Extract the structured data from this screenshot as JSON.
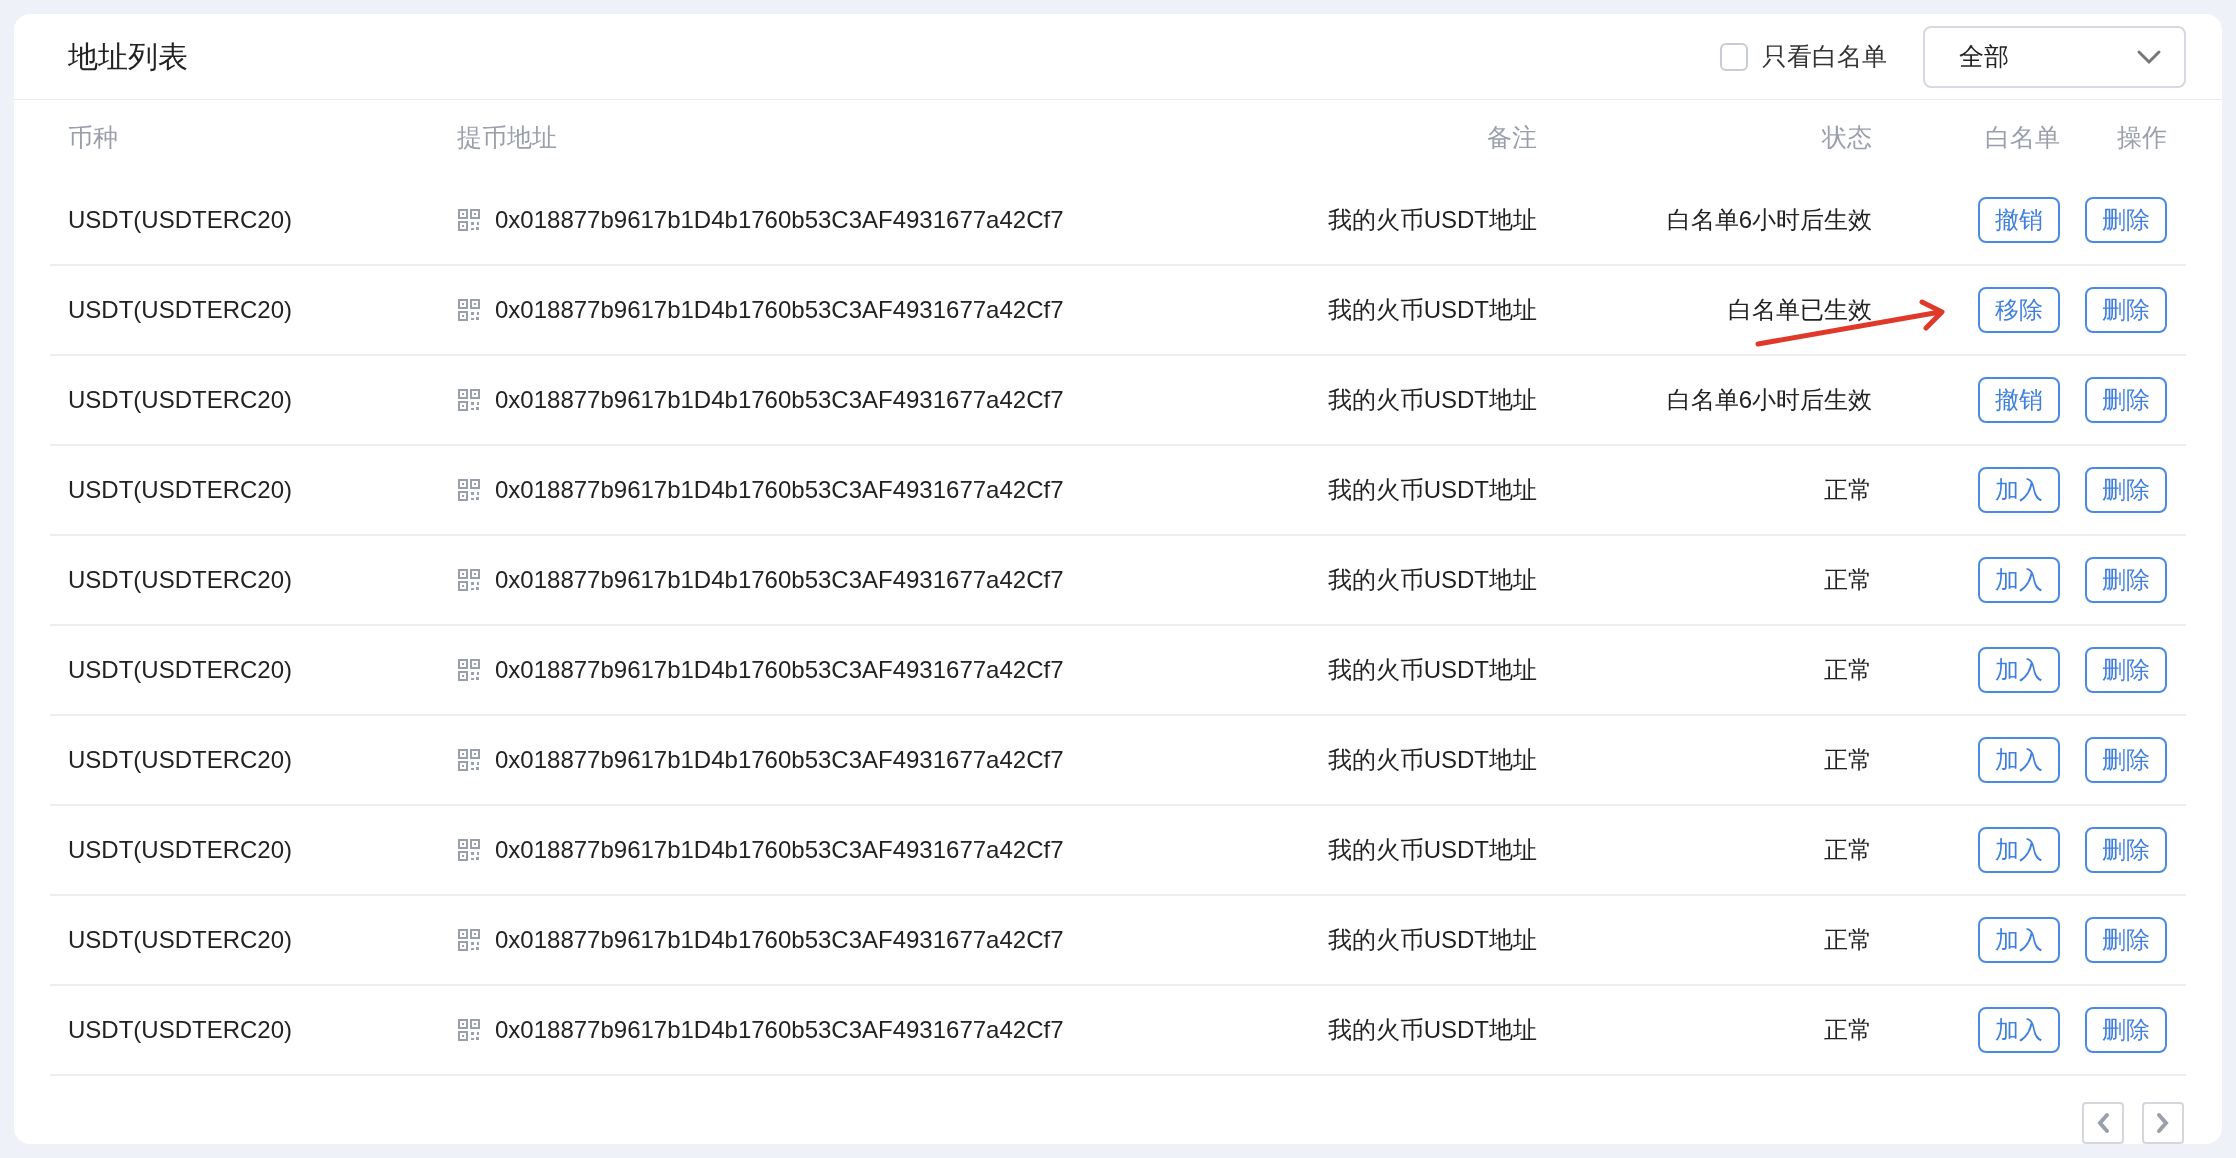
{
  "title": "地址列表",
  "filter": {
    "label": "只看白名单",
    "checked": false
  },
  "select": {
    "value": "全部"
  },
  "columns": [
    "币种",
    "提币地址",
    "备注",
    "状态",
    "白名单",
    "操作"
  ],
  "rows": [
    {
      "currency": "USDT(USDTERC20)",
      "address": "0x018877b9617b1D4b1760b53C3AF4931677a42Cf7",
      "note": "我的火币USDT地址",
      "status": "白名单6小时后生效",
      "whitelist_action": "撤销",
      "delete_action": "删除"
    },
    {
      "currency": "USDT(USDTERC20)",
      "address": "0x018877b9617b1D4b1760b53C3AF4931677a42Cf7",
      "note": "我的火币USDT地址",
      "status": "白名单已生效",
      "whitelist_action": "移除",
      "delete_action": "删除"
    },
    {
      "currency": "USDT(USDTERC20)",
      "address": "0x018877b9617b1D4b1760b53C3AF4931677a42Cf7",
      "note": "我的火币USDT地址",
      "status": "白名单6小时后生效",
      "whitelist_action": "撤销",
      "delete_action": "删除"
    },
    {
      "currency": "USDT(USDTERC20)",
      "address": "0x018877b9617b1D4b1760b53C3AF4931677a42Cf7",
      "note": "我的火币USDT地址",
      "status": "正常",
      "whitelist_action": "加入",
      "delete_action": "删除"
    },
    {
      "currency": "USDT(USDTERC20)",
      "address": "0x018877b9617b1D4b1760b53C3AF4931677a42Cf7",
      "note": "我的火币USDT地址",
      "status": "正常",
      "whitelist_action": "加入",
      "delete_action": "删除"
    },
    {
      "currency": "USDT(USDTERC20)",
      "address": "0x018877b9617b1D4b1760b53C3AF4931677a42Cf7",
      "note": "我的火币USDT地址",
      "status": "正常",
      "whitelist_action": "加入",
      "delete_action": "删除"
    },
    {
      "currency": "USDT(USDTERC20)",
      "address": "0x018877b9617b1D4b1760b53C3AF4931677a42Cf7",
      "note": "我的火币USDT地址",
      "status": "正常",
      "whitelist_action": "加入",
      "delete_action": "删除"
    },
    {
      "currency": "USDT(USDTERC20)",
      "address": "0x018877b9617b1D4b1760b53C3AF4931677a42Cf7",
      "note": "我的火币USDT地址",
      "status": "正常",
      "whitelist_action": "加入",
      "delete_action": "删除"
    },
    {
      "currency": "USDT(USDTERC20)",
      "address": "0x018877b9617b1D4b1760b53C3AF4931677a42Cf7",
      "note": "我的火币USDT地址",
      "status": "正常",
      "whitelist_action": "加入",
      "delete_action": "删除"
    },
    {
      "currency": "USDT(USDTERC20)",
      "address": "0x018877b9617b1D4b1760b53C3AF4931677a42Cf7",
      "note": "我的火币USDT地址",
      "status": "正常",
      "whitelist_action": "加入",
      "delete_action": "删除"
    }
  ]
}
